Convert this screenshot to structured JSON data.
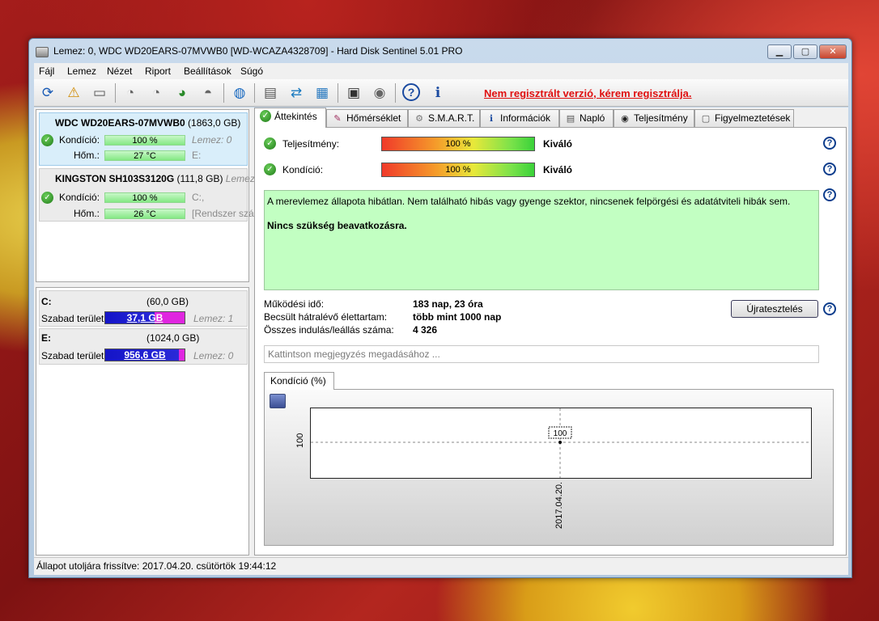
{
  "window": {
    "title": "Lemez: 0, WDC WD20EARS-07MVWB0 [WD-WCAZA4328709]  -  Hard Disk Sentinel 5.01 PRO",
    "minimize": "▁",
    "maximize": "▢",
    "close": "✕"
  },
  "menu": [
    "Fájl",
    "Lemez",
    "Nézet",
    "Riport",
    "Beállítások",
    "Súgó"
  ],
  "toolbar": {
    "register_msg": "Nem regisztrált verzió, kérem regisztrálja."
  },
  "disks": [
    {
      "name": "WDC WD20EARS-07MVWB0",
      "size": "(1863,0 GB)",
      "health_label": "Kondíció:",
      "health": "100 %",
      "health_extra": "Lemez: 0",
      "temp_label": "Hőm.:",
      "temp": "27 °C",
      "temp_extra": "E:"
    },
    {
      "name": "KINGSTON SH103S3120G",
      "size": "(111,8 GB)",
      "size_extra": "Lemez",
      "health_label": "Kondíció:",
      "health": "100 %",
      "health_extra": "C:,",
      "temp_label": "Hőm.:",
      "temp": "26 °C",
      "temp_extra": "[Rendszer szá"
    }
  ],
  "partitions": [
    {
      "letter": "C:",
      "size": "(60,0 GB)",
      "free_label": "Szabad terület",
      "free": "37,1 GB",
      "disk": "Lemez: 1",
      "free_fraction": 0.62
    },
    {
      "letter": "E:",
      "size": "(1024,0 GB)",
      "free_label": "Szabad terület",
      "free": "956,6 GB",
      "disk": "Lemez: 0",
      "free_fraction": 0.93
    }
  ],
  "tabs": [
    "Áttekintés",
    "Hőmérséklet",
    "S.M.A.R.T.",
    "Információk",
    "Napló",
    "Teljesítmény",
    "Figyelmeztetések"
  ],
  "overview": {
    "performance_label": "Teljesítmény:",
    "performance": "100 %",
    "performance_rating": "Kiváló",
    "health_label": "Kondíció:",
    "health": "100 %",
    "health_rating": "Kiváló",
    "description": "A merevlemez állapota hibátlan. Nem található hibás vagy gyenge szektor, nincsenek felpörgési és adatátviteli hibák sem.",
    "action": "Nincs szükség beavatkozásra.",
    "uptime_label": "Működési idő:",
    "uptime": "183 nap, 23 óra",
    "lifetime_label": "Becsült hátralévő élettartam:",
    "lifetime": "több mint 1000 nap",
    "starts_label": "Összes indulás/leállás száma:",
    "starts": "4 326",
    "retest_button": "Újratesztelés",
    "note_placeholder": "Kattintson megjegyzés megadásához ..."
  },
  "chart_data": {
    "type": "line",
    "tab_label": "Kondíció  (%)",
    "x": [
      "2017.04.20."
    ],
    "values": [
      100
    ],
    "ylabel": "100",
    "point_label": "100"
  },
  "status": "Állapot utoljára frissítve: 2017.04.20. csütörtök 19:44:12",
  "help_label": "?"
}
